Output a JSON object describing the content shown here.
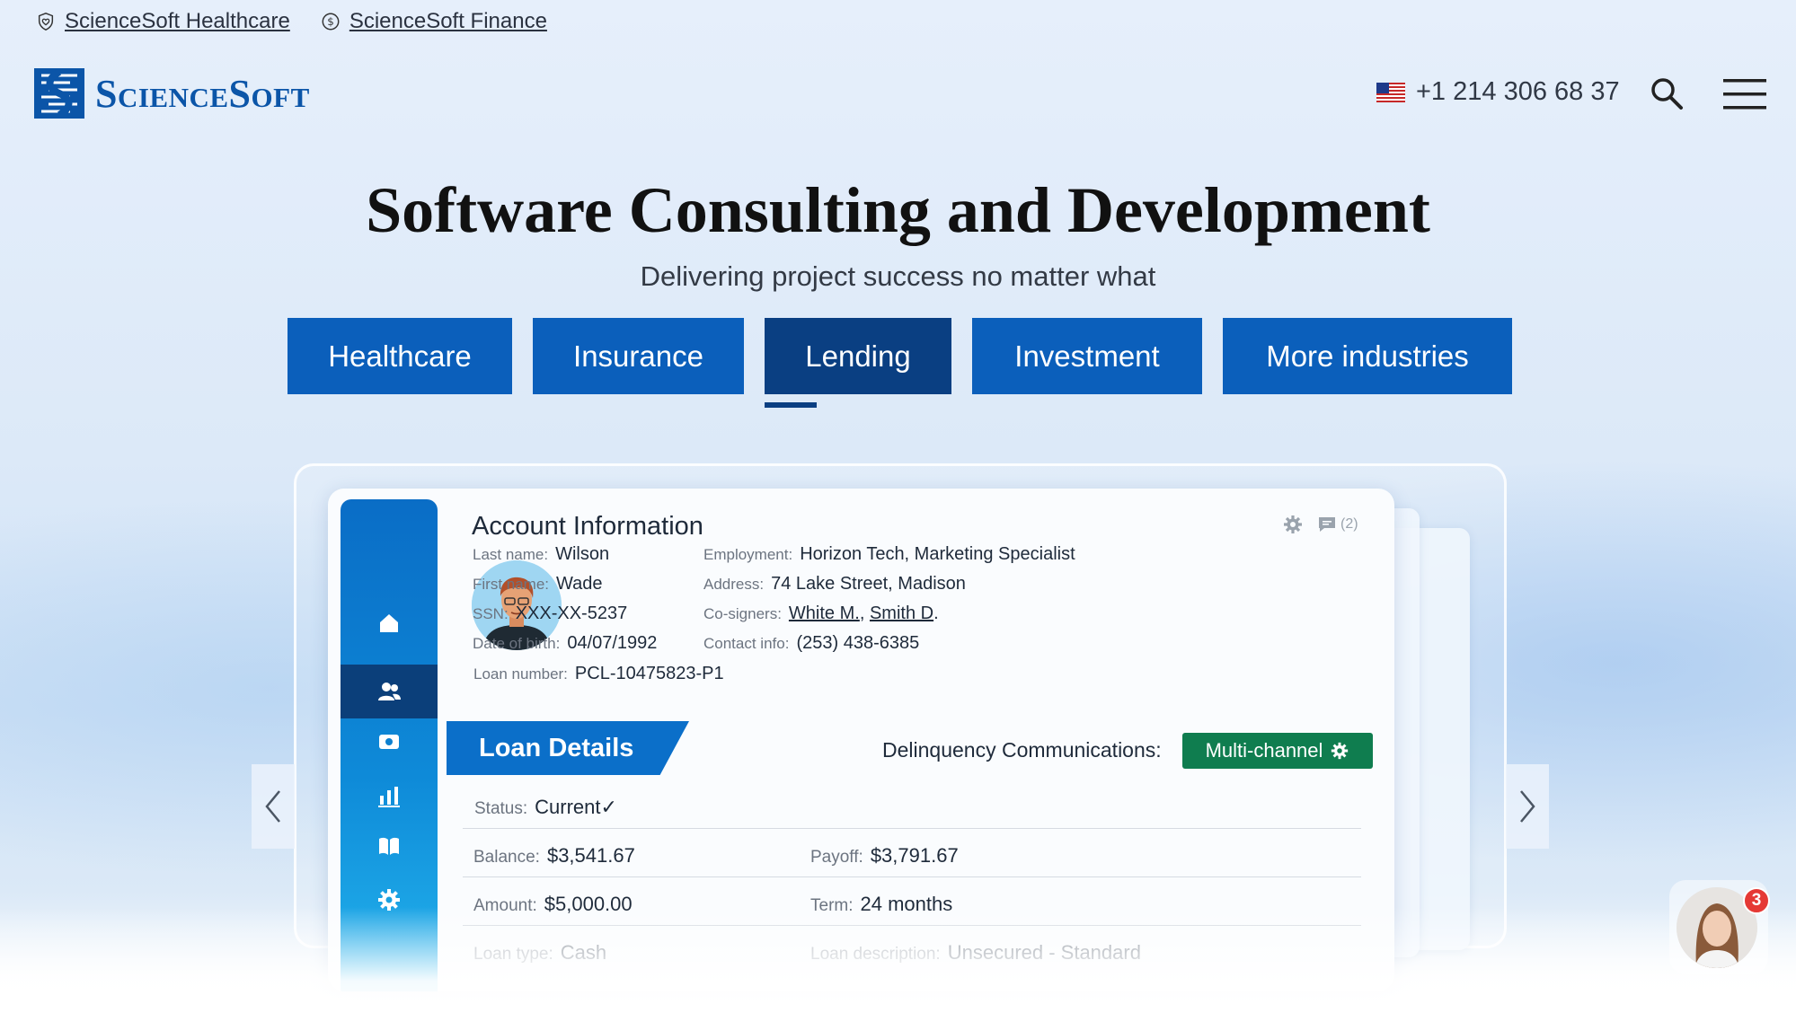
{
  "top_links": [
    {
      "label": "ScienceSoft Healthcare",
      "icon": "heart-shield-icon"
    },
    {
      "label": "ScienceSoft Finance",
      "icon": "dollar-coin-icon"
    }
  ],
  "header": {
    "logo_text": "ScienceSoft",
    "phone": "+1 214 306 68 37",
    "flag": "us-flag-icon"
  },
  "hero": {
    "title": "Software Consulting and Development",
    "subtitle": "Delivering project success no matter what"
  },
  "tabs": [
    {
      "label": "Healthcare",
      "active": false
    },
    {
      "label": "Insurance",
      "active": false
    },
    {
      "label": "Lending",
      "active": true
    },
    {
      "label": "Investment",
      "active": false
    },
    {
      "label": "More industries",
      "active": false
    }
  ],
  "card": {
    "title": "Account Information",
    "comments_count": "(2)",
    "personal": [
      {
        "label": "Last name:",
        "value": "Wilson"
      },
      {
        "label": "First name:",
        "value": "Wade"
      },
      {
        "label": "SSN:",
        "value": "XXX-XX-5237"
      },
      {
        "label": "Date of birth:",
        "value": "04/07/1992"
      },
      {
        "label": "Loan number:",
        "value": "PCL-10475823-P1"
      }
    ],
    "employment": {
      "label": "Employment:",
      "value": "Horizon Tech, Marketing Specialist"
    },
    "address": {
      "label": "Address:",
      "value": "74 Lake Street, Madison"
    },
    "cosigners": {
      "label": "Co-signers:",
      "value_1": "White M.",
      "separator": ",",
      "value_2": "Smith D",
      "end": "."
    },
    "contact": {
      "label": "Contact info:",
      "value": "(253) 438-6385"
    },
    "loan_tab": "Loan Details",
    "delinquency_label": "Delinquency Communications:",
    "delinquency_value": "Multi-channel",
    "status": {
      "label": "Status:",
      "value": "Current✓"
    },
    "balance": {
      "label": "Balance:",
      "value": "$3,541.67"
    },
    "payoff": {
      "label": "Payoff:",
      "value": "$3,791.67"
    },
    "amount": {
      "label": "Amount:",
      "value": "$5,000.00"
    },
    "term": {
      "label": "Term:",
      "value": "24 months"
    },
    "loan_type": {
      "label": "Loan type:",
      "value": "Cash"
    },
    "loan_description": {
      "label": "Loan description:",
      "value": "Unsecured - Standard"
    }
  },
  "chat": {
    "badge": "3"
  },
  "colors": {
    "brand_blue": "#0b5fbb",
    "active_tab": "#0a3f82",
    "multi_green": "#0f7d4f",
    "badge_red": "#e53935"
  }
}
